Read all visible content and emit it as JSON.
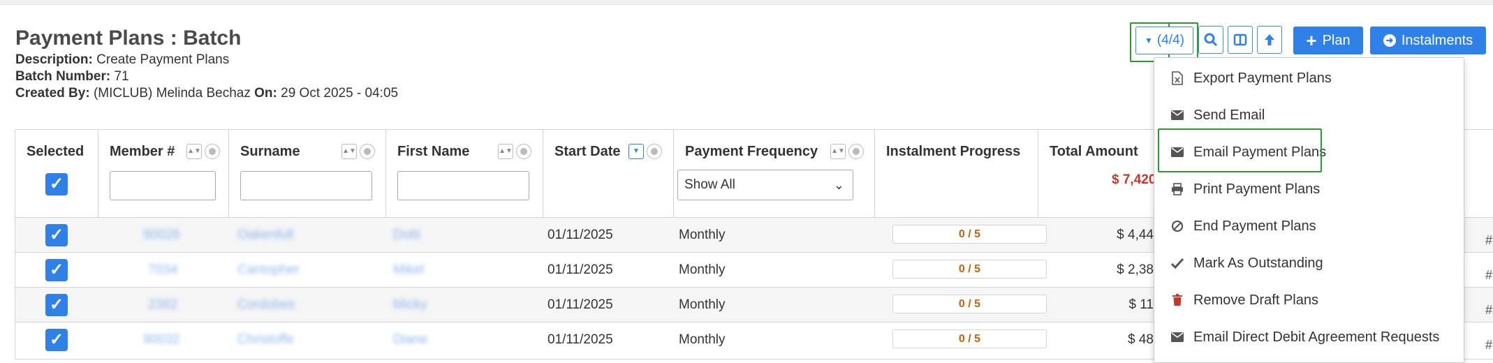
{
  "page": {
    "title": "Payment Plans : Batch",
    "description_label": "Description:",
    "description": "Create Payment Plans",
    "batch_number_label": "Batch Number:",
    "batch_number": "71",
    "created_by_label": "Created By:",
    "created_by": "(MICLUB) Melinda Bechaz",
    "on_label": "On:",
    "created_on": "29 Oct 2025 - 04:05"
  },
  "toolbar": {
    "selection_count": "(4/4)",
    "plan_label": "Plan",
    "instalments_label": "Instalments"
  },
  "table": {
    "headers": {
      "selected": "Selected",
      "member": "Member #",
      "surname": "Surname",
      "first_name": "First Name",
      "start_date": "Start Date",
      "payment_frequency": "Payment Frequency",
      "instalment_progress": "Instalment Progress",
      "total_amount": "Total Amount"
    },
    "frequency_filter": "Show All",
    "total_amount_sum": "$ 7,420",
    "rows": [
      {
        "member": "90026",
        "surname": "Oakenfull",
        "first_name": "Dotti",
        "start_date": "01/11/2025",
        "frequency": "Monthly",
        "progress": "0 / 5",
        "total": "$ 4,44"
      },
      {
        "member": "7034",
        "surname": "Cantopher",
        "first_name": "Mikel",
        "start_date": "01/11/2025",
        "frequency": "Monthly",
        "progress": "0 / 5",
        "total": "$ 2,38"
      },
      {
        "member": "2382",
        "surname": "Cordobes",
        "first_name": "Micky",
        "start_date": "01/11/2025",
        "frequency": "Monthly",
        "progress": "0 / 5",
        "total": "$ 11"
      },
      {
        "member": "90032",
        "surname": "Christoffe",
        "first_name": "Diane",
        "start_date": "01/11/2025",
        "frequency": "Monthly",
        "progress": "0 / 5",
        "total": "$ 48"
      }
    ]
  },
  "menu": {
    "items": [
      {
        "label": "Export Payment Plans",
        "icon": "file-excel-icon"
      },
      {
        "label": "Send Email",
        "icon": "envelope-icon"
      },
      {
        "label": "Email Payment Plans",
        "icon": "envelope-icon"
      },
      {
        "label": "Print Payment Plans",
        "icon": "print-icon"
      },
      {
        "label": "End Payment Plans",
        "icon": "ban-icon"
      },
      {
        "label": "Mark As Outstanding",
        "icon": "check-icon"
      },
      {
        "label": "Remove Draft Plans",
        "icon": "trash-icon"
      },
      {
        "label": "Email Direct Debit Agreement Requests",
        "icon": "envelope-icon"
      }
    ]
  },
  "colors": {
    "primary": "#2f80e7",
    "highlight": "#2e9a2e",
    "total_sum": "#c0392b",
    "progress_text": "#c0620e"
  }
}
